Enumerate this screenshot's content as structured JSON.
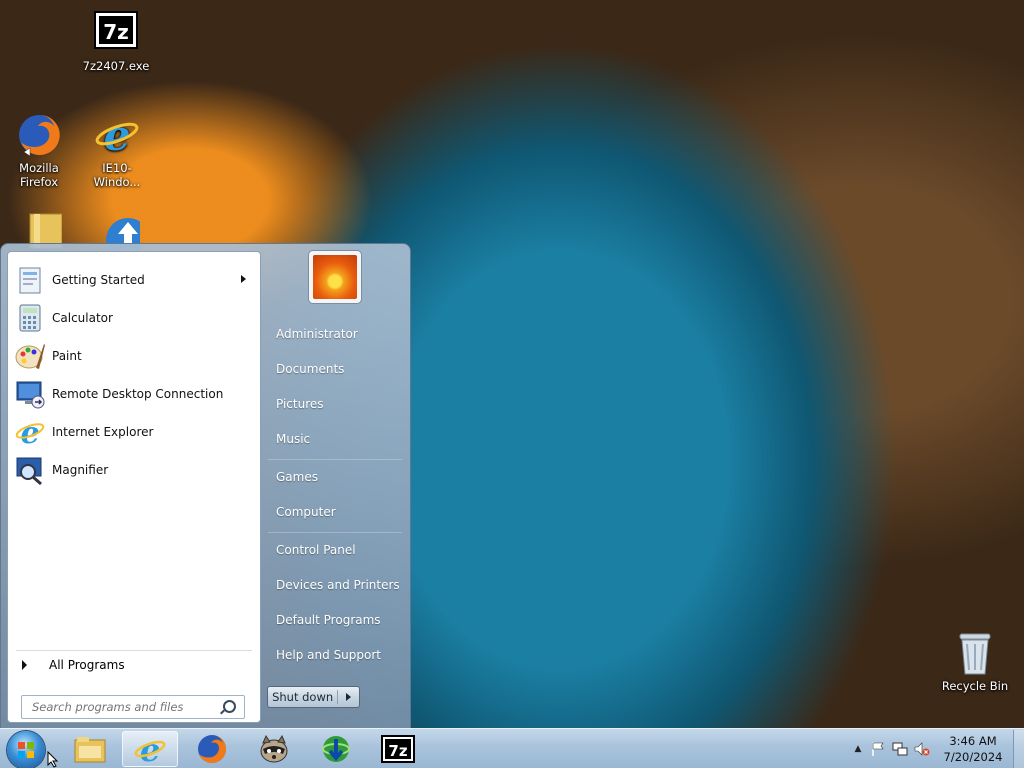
{
  "desktop": {
    "icons": [
      {
        "label": "7z2407.exe",
        "icon": "7zip-icon"
      },
      {
        "label": "Mozilla Firefox",
        "icon": "firefox-icon"
      },
      {
        "label": "IE10-Windo...",
        "icon": "internet-explorer-icon"
      },
      {
        "label": "",
        "icon": "folder-icon"
      },
      {
        "label": "",
        "icon": "network-icon"
      },
      {
        "label": "Recycle Bin",
        "icon": "recycle-bin-icon"
      }
    ]
  },
  "start_menu": {
    "programs": [
      {
        "label": "Getting Started",
        "icon": "getting-started-icon",
        "has_submenu": true
      },
      {
        "label": "Calculator",
        "icon": "calculator-icon"
      },
      {
        "label": "Paint",
        "icon": "paint-icon"
      },
      {
        "label": "Remote Desktop Connection",
        "icon": "remote-desktop-icon"
      },
      {
        "label": "Internet Explorer",
        "icon": "internet-explorer-icon"
      },
      {
        "label": "Magnifier",
        "icon": "magnifier-icon"
      }
    ],
    "all_programs": "All Programs",
    "search_placeholder": "Search programs and files",
    "right_items": [
      "Administrator",
      "Documents",
      "Pictures",
      "Music",
      "Games",
      "Computer",
      "Control Panel",
      "Devices and Printers",
      "Default Programs",
      "Help and Support"
    ],
    "shutdown_label": "Shut down"
  },
  "taskbar": {
    "pinned": [
      "file-explorer-icon",
      "internet-explorer-icon",
      "firefox-icon",
      "raccoon-app-icon",
      "download-manager-icon",
      "7zip-icon"
    ],
    "active": "internet-explorer-icon",
    "clock": {
      "time": "3:46 AM",
      "date": "7/20/2024"
    },
    "tray_icons": [
      "show-hidden-icons-chevron-icon",
      "action-center-flag-icon",
      "network-icon",
      "volume-muted-icon"
    ]
  }
}
